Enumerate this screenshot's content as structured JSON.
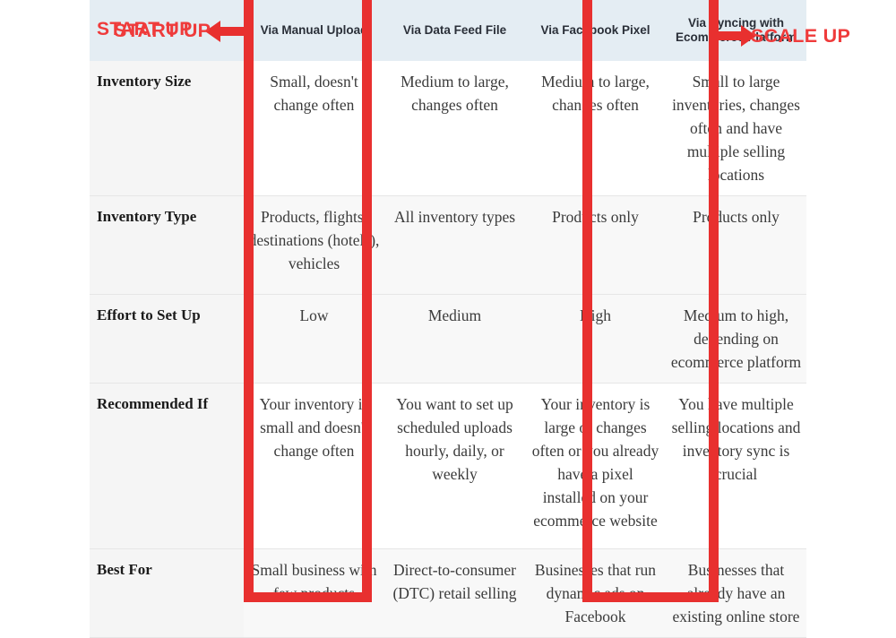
{
  "annotations": {
    "start_up_label": "START UP",
    "scale_up_label": "SCALE UP",
    "left_arrow_icon": "arrow-left-icon",
    "right_arrow_icon": "arrow-right-icon",
    "highlight_color": "#e8302f",
    "accent_color": "#ef3b3b",
    "header_bg": "#e4edf3"
  },
  "table": {
    "corner_label": "",
    "columns": [
      "Via Manual Upload",
      "Via Data Feed File",
      "Via Facebook Pixel",
      "Via Syncing with Ecommerce Platform"
    ],
    "highlighted_columns": [
      0,
      3
    ],
    "rows": [
      {
        "label": "Inventory Size",
        "cells": [
          "Small, doesn't change often",
          "Medium to large, changes often",
          "Medium to large, changes often",
          "Small to large inventories, changes often and have multiple selling locations"
        ]
      },
      {
        "label": "Inventory Type",
        "cells": [
          "Products, flights, destinations (hotels), vehicles",
          "All inventory types",
          "Products only",
          "Products only"
        ]
      },
      {
        "label": "Effort to Set Up",
        "cells": [
          "Low",
          "Medium",
          "High",
          "Medium to high, depending on ecommerce platform"
        ]
      },
      {
        "label": "Recommended If",
        "cells": [
          "Your inventory is small and doesn't change often",
          "You want to set up scheduled uploads hourly, daily, or weekly",
          "Your inventory is large or changes often or you already have a pixel installed on your ecommerce website",
          "You have multiple selling locations and inventory sync is crucial"
        ]
      },
      {
        "label": "Best For",
        "cells": [
          "Small business with few products",
          "Direct-to-consumer (DTC) retail selling",
          "Businesses that run dynamic ads on Facebook",
          "Businesses that already have an existing online store"
        ]
      }
    ]
  }
}
